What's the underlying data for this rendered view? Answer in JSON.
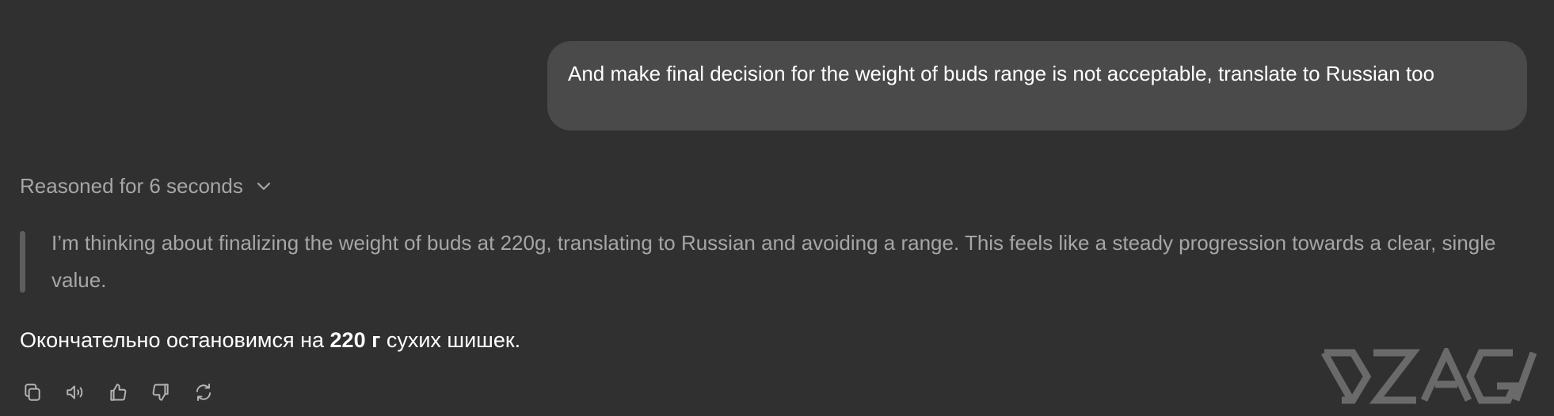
{
  "user_message": {
    "text": "And make final decision for the weight of buds range is not acceptable, translate to Russian too"
  },
  "reasoning": {
    "label": "Reasoned for 6 seconds",
    "thought": "I’m thinking about finalizing the weight of buds at 220g, translating to Russian and avoiding a range. This feels like a steady progression towards a clear, single value."
  },
  "answer": {
    "before": "Окончательно остановимся на ",
    "bold": "220 г",
    "after": " сухих шишек."
  },
  "toolbar": {
    "icons": [
      "copy-icon",
      "read-aloud-icon",
      "thumbs-up-icon",
      "thumbs-down-icon",
      "regenerate-icon"
    ]
  },
  "watermark": {
    "text": "DZAGI"
  },
  "colors": {
    "background": "#303030",
    "bubble": "#4a4a4a",
    "muted_text": "#a6a6a6",
    "primary_text": "#ffffff",
    "icon": "#b4b4b4",
    "watermark": "#6a6a6a"
  }
}
